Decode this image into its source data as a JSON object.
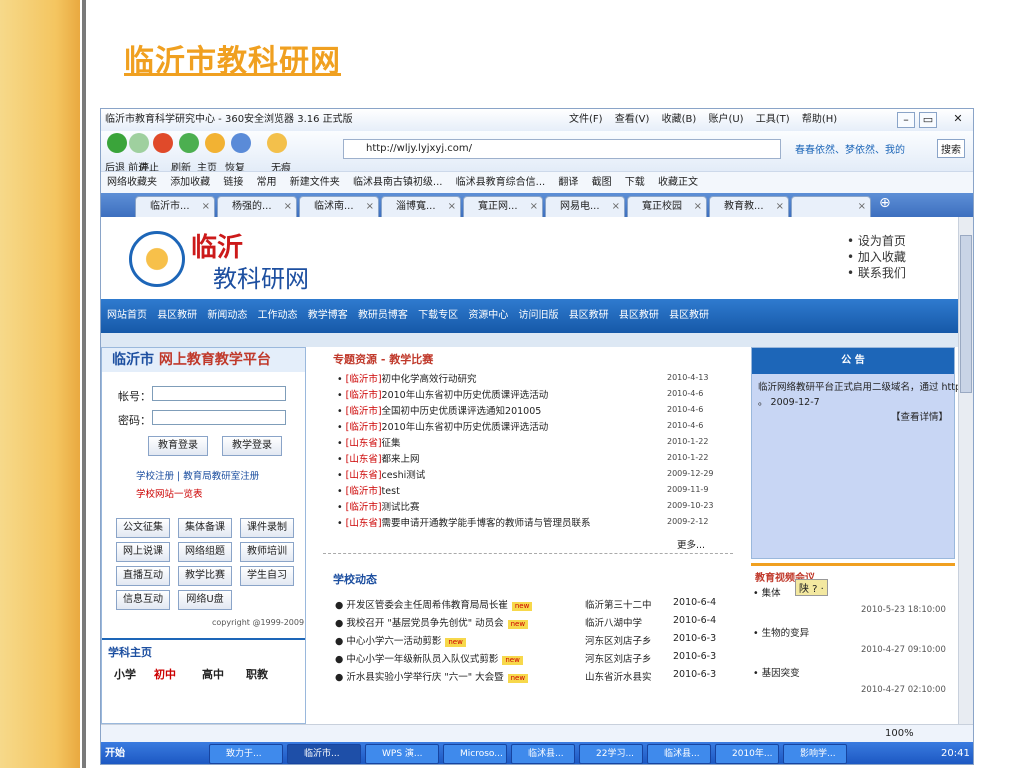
{
  "slide": {
    "title": "临沂市教科研网"
  },
  "browser": {
    "window_title": "临沂市教育科学研究中心 - 360安全浏览器 3.16 正式版",
    "menus": [
      "文件(F)",
      "查看(V)",
      "收藏(B)",
      "账户(U)",
      "工具(T)",
      "帮助(H)"
    ],
    "nav_labels": [
      "后退 前进",
      "停止",
      "刷新",
      "主页",
      "恢复",
      "无痕"
    ],
    "url": "http://wljy.lyjxyj.com/",
    "search_box": "春春依然、梦依然、我的",
    "search_button": "搜索",
    "favorites": [
      "网络收藏夹",
      "添加收藏",
      "链接",
      "常用",
      "新建文件夹",
      "临沭县南古镇初级...",
      "临沭县教育综合信..."
    ],
    "tools": [
      "翻译",
      "截图",
      "下载",
      "收藏正文"
    ],
    "tabs": [
      "临沂市...",
      "杨强的...",
      "临沭南...",
      "淄博寬...",
      "寬正网...",
      "网易电...",
      "寬正校园",
      "教育教..."
    ],
    "zoom": "100%"
  },
  "site": {
    "name_line1": "临沂",
    "name_line2": "教科研网",
    "header_links": [
      "• 设为首页",
      "• 加入收藏",
      "• 联系我们"
    ],
    "nav": [
      "网站首页",
      "县区教研",
      "新闻动态",
      "工作动态",
      "教学博客",
      "教研员博客",
      "下载专区",
      "资源中心",
      "访问旧版",
      "县区教研",
      "县区教研",
      "县区教研"
    ]
  },
  "login": {
    "city": "临沂市",
    "platform": "网上教育教学平台",
    "account_label": "帐号：",
    "password_label": "密码：",
    "buttons": [
      "教育登录",
      "教学登录"
    ],
    "register_links": "学校注册 | 教育局教研室注册",
    "school_list": "学校网站一览表",
    "quick_links": [
      "公文征集",
      "集体备课",
      "课件录制",
      "网上说课",
      "网络组题",
      "教师培训",
      "直播互动",
      "教学比赛",
      "学生自习",
      "信息互动",
      "网络U盘"
    ],
    "copyright": "copyright @1999-2009",
    "subject_title": "学科主页",
    "levels": [
      "小学",
      "初中",
      "高中",
      "职教"
    ]
  },
  "news": {
    "section1_title": "专题资源 - 教学比赛",
    "items": [
      {
        "tag": "[临沂市]",
        "text": "初中化学高效行动研究",
        "date": "2010-4-13"
      },
      {
        "tag": "[临沂市]",
        "text": "2010年山东省初中历史优质课评选活动",
        "date": "2010-4-6"
      },
      {
        "tag": "[临沂市]",
        "text": "全国初中历史优质课评选通知201005",
        "date": "2010-4-6"
      },
      {
        "tag": "[临沂市]",
        "text": "2010年山东省初中历史优质课评选活动",
        "date": "2010-4-6"
      },
      {
        "tag": "[山东省]",
        "text": "征集",
        "date": "2010-1-22"
      },
      {
        "tag": "[山东省]",
        "text": "都来上网",
        "date": "2010-1-22"
      },
      {
        "tag": "[山东省]",
        "text": "ceshi测试",
        "date": "2009-12-29"
      },
      {
        "tag": "[临沂市]",
        "text": "test",
        "date": "2009-11-9"
      },
      {
        "tag": "[临沂市]",
        "text": "测试比赛",
        "date": "2009-10-23"
      },
      {
        "tag": "[山东省]",
        "text": "需要申请开通教学能手博客的教师请与管理员联系",
        "date": "2009-2-12"
      }
    ],
    "more": "更多...",
    "section2_title": "学校动态"
  },
  "school": {
    "new_badge": "new",
    "items": [
      {
        "text": "开发区管委会主任周希伟教育局局长崔",
        "source": "临沂第三十二中",
        "date": "2010-6-4"
      },
      {
        "text": "我校召开 \"基层党员争先创优\" 动员会",
        "source": "临沂八湖中学",
        "date": "2010-6-4"
      },
      {
        "text": "中心小学六一活动剪影",
        "source": "河东区刘店子乡",
        "date": "2010-6-3"
      },
      {
        "text": "中心小学一年级新队员入队仪式剪影",
        "source": "河东区刘店子乡",
        "date": "2010-6-3"
      },
      {
        "text": "沂水县实验小学举行庆 \"六一\" 大会暨",
        "source": "山东省沂水县实",
        "date": "2010-6-3"
      }
    ]
  },
  "notice": {
    "title": "公 告",
    "body": "临沂网络教研平台正式启用二级域名，通过 http://wljy.lyjxyj.com 即可访问",
    "date": "。 2009-12-7",
    "detail_link": "【查看详情】"
  },
  "video": {
    "title": "教育视频会议",
    "ime": "陕 ? ·",
    "items": [
      {
        "title": "• 集体",
        "date": "2010-5-23 18:10:00"
      },
      {
        "title": "• 生物的变异",
        "date": "2010-4-27 09:10:00"
      },
      {
        "title": "• 基因突变",
        "date": "2010-4-27 02:10:00"
      }
    ]
  },
  "taskbar": {
    "start": "开始",
    "items": [
      "致力于...",
      "临沂市...",
      "WPS 演...",
      "Microso...",
      "临沭县...",
      "22学习...",
      "临沭县...",
      "2010年...",
      "影响学..."
    ],
    "clock": "20:41"
  }
}
